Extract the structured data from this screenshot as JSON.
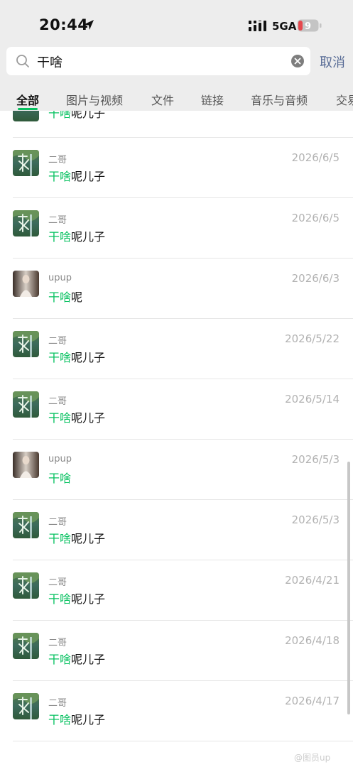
{
  "status_bar": {
    "time": "20:44",
    "network": "5GA",
    "battery": "9"
  },
  "search": {
    "query": "干啥",
    "cancel_label": "取消"
  },
  "tabs": [
    {
      "label": "全部",
      "active": true
    },
    {
      "label": "图片与视频",
      "active": false
    },
    {
      "label": "文件",
      "active": false
    },
    {
      "label": "链接",
      "active": false
    },
    {
      "label": "音乐与音频",
      "active": false
    },
    {
      "label": "交易",
      "active": false
    }
  ],
  "partial_row": {
    "highlight": "干啥",
    "rest": "呢儿子"
  },
  "results": [
    {
      "sender": "二哥",
      "date": "2026/6/5",
      "highlight": "干啥",
      "rest": "呢儿子",
      "avatar": "landscape"
    },
    {
      "sender": "二哥",
      "date": "2026/6/5",
      "highlight": "干啥",
      "rest": "呢儿子",
      "avatar": "landscape"
    },
    {
      "sender": "upup",
      "date": "2026/6/3",
      "highlight": "干啥",
      "rest": "呢",
      "avatar": "portrait"
    },
    {
      "sender": "二哥",
      "date": "2026/5/22",
      "highlight": "干啥",
      "rest": "呢儿子",
      "avatar": "landscape"
    },
    {
      "sender": "二哥",
      "date": "2026/5/14",
      "highlight": "干啥",
      "rest": "呢儿子",
      "avatar": "landscape"
    },
    {
      "sender": "upup",
      "date": "2026/5/3",
      "highlight": "干啥",
      "rest": "",
      "avatar": "portrait"
    },
    {
      "sender": "二哥",
      "date": "2026/5/3",
      "highlight": "干啥",
      "rest": "呢儿子",
      "avatar": "landscape"
    },
    {
      "sender": "二哥",
      "date": "2026/4/21",
      "highlight": "干啥",
      "rest": "呢儿子",
      "avatar": "landscape"
    },
    {
      "sender": "二哥",
      "date": "2026/4/18",
      "highlight": "干啥",
      "rest": "呢儿子",
      "avatar": "landscape"
    },
    {
      "sender": "二哥",
      "date": "2026/4/17",
      "highlight": "干啥",
      "rest": "呢儿子",
      "avatar": "landscape"
    }
  ],
  "watermark": "@图员up",
  "colors": {
    "highlight": "#07c160",
    "cancel": "#576b95",
    "background_top": "#ededed"
  }
}
